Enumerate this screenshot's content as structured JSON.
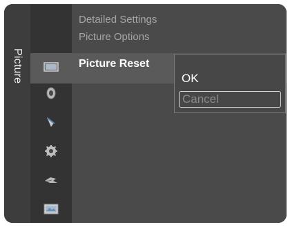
{
  "sidebar": {
    "title": "Picture"
  },
  "icons": [
    {
      "name": "picture-icon",
      "active": true
    },
    {
      "name": "sound-icon"
    },
    {
      "name": "channel-icon"
    },
    {
      "name": "setup-icon"
    },
    {
      "name": "input-icon"
    },
    {
      "name": "application-icon"
    }
  ],
  "menu": {
    "items": [
      {
        "label": "Detailed Settings"
      },
      {
        "label": "Picture Options"
      },
      {
        "label": "Picture Reset"
      }
    ]
  },
  "popup": {
    "options": [
      {
        "label": "OK"
      },
      {
        "label": "Cancel"
      }
    ]
  },
  "colors": {
    "panel": "#474747",
    "icon_column": "#333333",
    "highlight": "#5a5a5a",
    "active_text": "#ffffff",
    "inactive_text": "#a6a6a6"
  }
}
